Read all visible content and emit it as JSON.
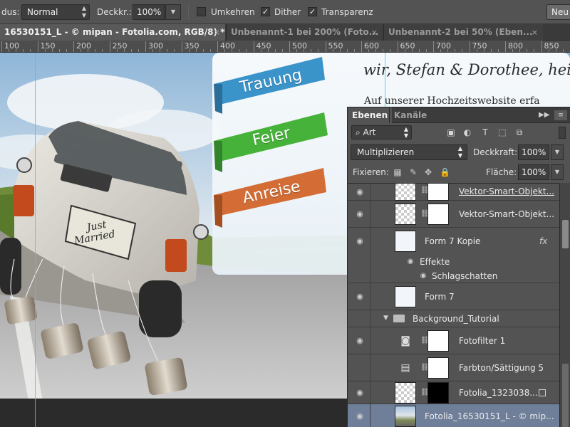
{
  "options_bar": {
    "mode_label": "dus:",
    "mode_value": "Normal",
    "opacity_label": "Deckkr.:",
    "opacity_value": "100%",
    "invert_label": "Umkehren",
    "invert_checked": false,
    "dither_label": "Dither",
    "dither_checked": true,
    "transparency_label": "Transparenz",
    "transparency_checked": true,
    "new_button": "Neu"
  },
  "tabs": [
    {
      "label": "16530151_L - © mipan - Fotolia.com, RGB/8) *",
      "active": true,
      "close": "×"
    },
    {
      "label": "Unbenannt-1 bei 200% (Foto...",
      "active": false,
      "close": "×"
    },
    {
      "label": "Unbenannt-2 bei 50% (Eben...",
      "active": false,
      "close": "×"
    }
  ],
  "ruler": {
    "labels": [
      "100",
      "150",
      "200",
      "250",
      "300",
      "350",
      "400",
      "450",
      "500",
      "550",
      "600",
      "650",
      "700",
      "750",
      "800",
      "850"
    ]
  },
  "canvas": {
    "headline": "wir, Stefan & Dorothee, hei",
    "subline": "Auf unserer Hochzeitswebsite erfa",
    "ribbons": [
      {
        "label": "Trauung",
        "color": "#3a93c9"
      },
      {
        "label": "Feier",
        "color": "#47b23a"
      },
      {
        "label": "Anreise",
        "color": "#d36d35"
      }
    ],
    "plate_line1": "Just",
    "plate_line2": "Married"
  },
  "layers_panel": {
    "tab_layers": "Ebenen",
    "tab_channels": "Kanäle",
    "collapse_icon": "double-chevron-right-icon",
    "filter_value": "Art",
    "filter_icons": [
      "image-filter-icon",
      "adjustment-filter-icon",
      "type-filter-icon",
      "shape-filter-icon",
      "smart-object-filter-icon"
    ],
    "blend_mode": "Multiplizieren",
    "opacity_label": "Deckkraft:",
    "opacity_value": "100%",
    "lock_label": "Fixieren:",
    "fill_label": "Fläche:",
    "fill_value": "100%",
    "lock_icons": [
      "lock-transparency-icon",
      "lock-paint-icon",
      "lock-move-icon",
      "lock-all-icon"
    ],
    "layers": [
      {
        "name": "Vektor-Smart-Objekt...",
        "type": "smart"
      },
      {
        "name": "Vektor-Smart-Objekt...",
        "type": "smart"
      },
      {
        "name": "Form 7 Kopie",
        "type": "shape",
        "fx": "fx"
      },
      {
        "name": "Effekte",
        "type": "effects-header"
      },
      {
        "name": "Schlagschatten",
        "type": "effect"
      },
      {
        "name": "Form 7",
        "type": "shape"
      },
      {
        "name": "Background_Tutorial",
        "type": "group"
      },
      {
        "name": "Fotofilter 1",
        "type": "adjustment"
      },
      {
        "name": "Farbton/Sättigung 5",
        "type": "adjustment"
      },
      {
        "name": "Fotolia_1323038...",
        "type": "masked-photo"
      },
      {
        "name": "Fotolia_16530151_L - © mip...",
        "type": "photo",
        "selected": true
      }
    ]
  },
  "colors": {
    "guide": "#3fc8e6",
    "selection": "#6f7f99",
    "panel_bg": "#535353"
  }
}
